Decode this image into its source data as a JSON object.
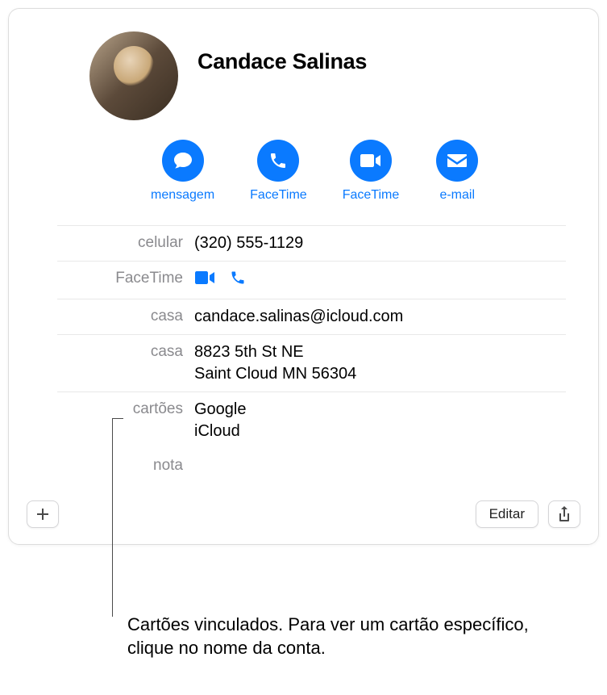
{
  "contact": {
    "name": "Candace Salinas"
  },
  "actions": {
    "message": "mensagem",
    "facetime_audio": "FaceTime",
    "facetime_video": "FaceTime",
    "email": "e-mail"
  },
  "fields": {
    "mobile": {
      "label": "celular",
      "value": "(320) 555-1129"
    },
    "facetime": {
      "label": "FaceTime"
    },
    "home_email": {
      "label": "casa",
      "value": "candace.salinas@icloud.com"
    },
    "home_address": {
      "label": "casa",
      "line1": "8823 5th St NE",
      "line2": "Saint Cloud MN 56304"
    },
    "cards": {
      "label": "cartões",
      "items": [
        "Google",
        "iCloud"
      ]
    },
    "note": {
      "label": "nota",
      "value": ""
    }
  },
  "toolbar": {
    "edit": "Editar"
  },
  "callout": {
    "text": "Cartões vinculados. Para ver um cartão específico, clique no nome da conta."
  }
}
